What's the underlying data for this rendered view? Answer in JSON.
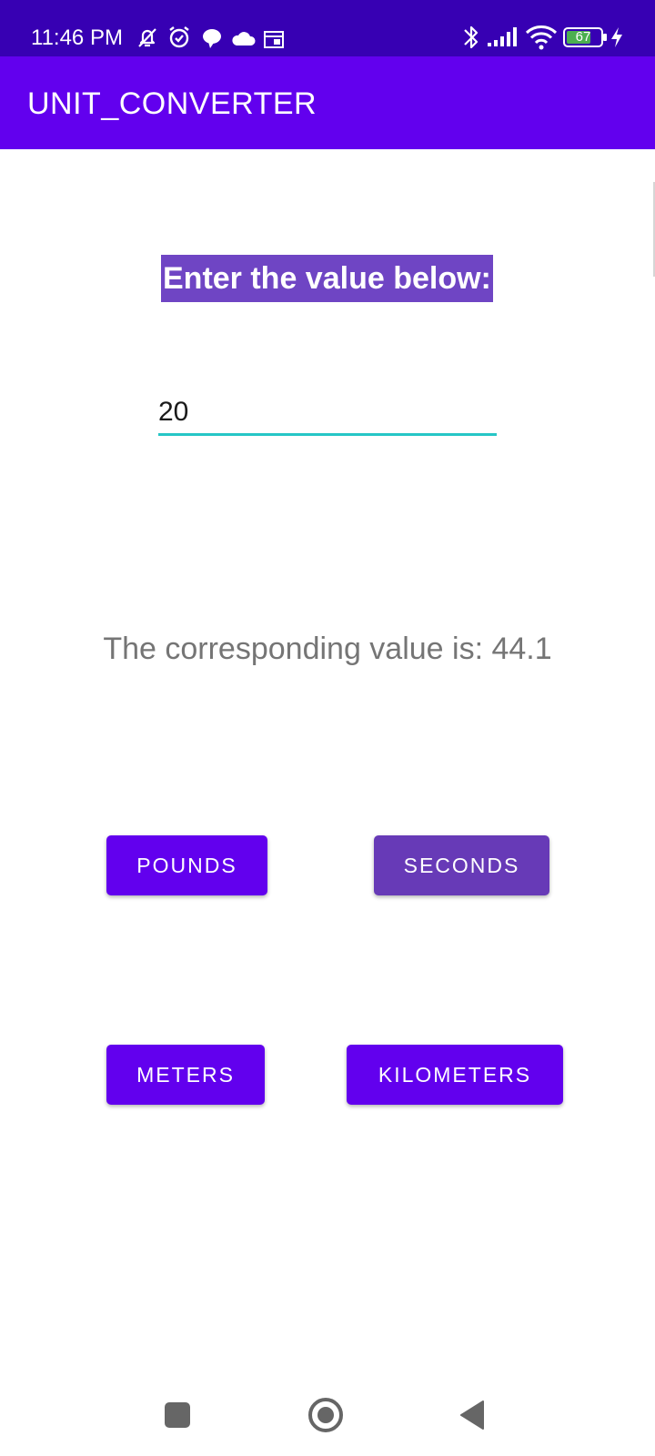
{
  "status_bar": {
    "time": "11:46 PM",
    "battery_level": "67",
    "icons": [
      "muted-icon",
      "alarm-icon",
      "chat-icon",
      "cloud-icon",
      "calendar-icon",
      "bluetooth-icon",
      "signal-icon",
      "wifi-icon",
      "battery-icon",
      "charging-icon"
    ]
  },
  "app_bar": {
    "title": "UNIT_CONVERTER"
  },
  "main": {
    "prompt": "Enter the value below:",
    "input_value": "20",
    "result_prefix": "The corresponding value is: ",
    "result_value": "44.1",
    "buttons": {
      "pounds": "POUNDS",
      "seconds": "SECONDS",
      "meters": "METERS",
      "kilometers": "KILOMETERS"
    }
  },
  "nav_bar": {
    "icons": [
      "recents-icon",
      "home-icon",
      "back-icon"
    ]
  },
  "colors": {
    "status_bar": "#3700b3",
    "app_bar": "#6200ee",
    "prompt_bg": "#6f45c4",
    "button": "#6200ee",
    "button_pressed": "#673ab7",
    "input_underline": "#26c6c6",
    "result_text": "#757575",
    "battery_fill": "#4caf50"
  }
}
